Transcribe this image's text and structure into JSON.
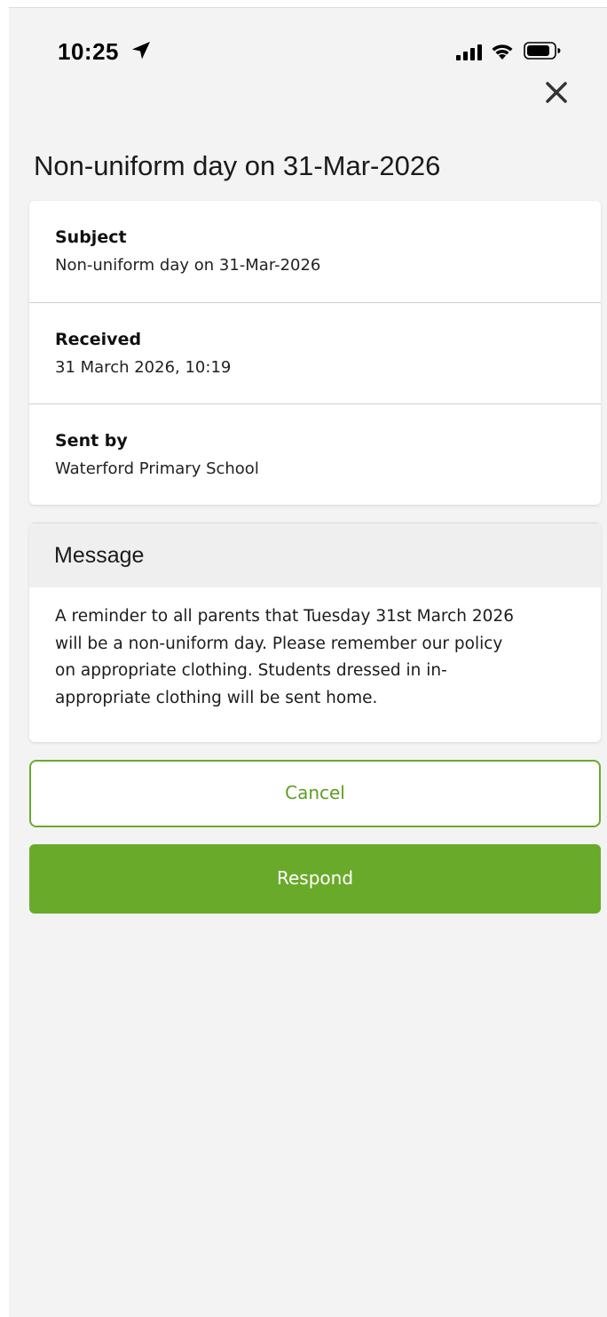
{
  "status_bar": {
    "time": "10:25",
    "icons": [
      "location-arrow-icon",
      "cellular-signal-icon",
      "wifi-icon",
      "battery-icon"
    ]
  },
  "header": {
    "close_icon": "close-icon",
    "title": "Non-uniform day on 31-Mar-2026"
  },
  "details": [
    {
      "label": "Subject",
      "value": "Non-uniform day on 31-Mar-2026"
    },
    {
      "label": "Received",
      "value": "31 March 2026, 10:19"
    },
    {
      "label": "Sent by",
      "value": "Waterford Primary School"
    }
  ],
  "message": {
    "header": "Message",
    "lines": [
      "A reminder to all parents that Tuesday 31st March 2026",
      "will be a non-uniform day. Please remember our policy",
      "on appropriate clothing. Students dressed in in-",
      "appropriate clothing will be sent home."
    ]
  },
  "actions": {
    "cancel_label": "Cancel",
    "respond_label": "Respond"
  },
  "colors": {
    "accent": "#6aaa2b",
    "background": "#f3f3f3",
    "card": "#ffffff"
  }
}
